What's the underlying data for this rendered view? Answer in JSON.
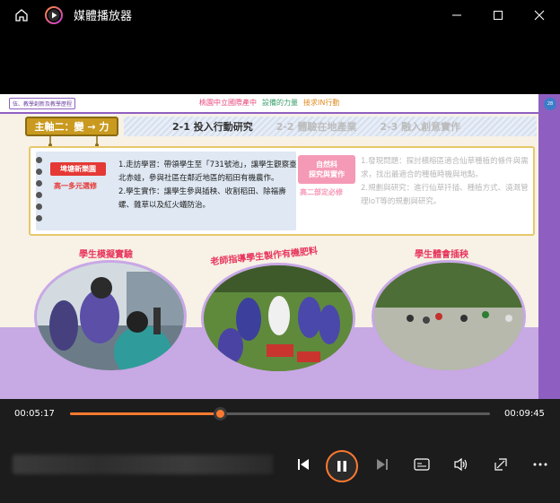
{
  "window": {
    "title": "媒體播放器",
    "home_icon": "home-icon",
    "app_icon": "media-player-logo-icon",
    "minimize_icon": "minimize-icon",
    "maximize_icon": "maximize-icon",
    "close_icon": "close-icon"
  },
  "slide": {
    "section_tag": "伍、教學創新及教學歷程",
    "banner": [
      "桃園中立國際產中",
      "設備的力量",
      "接求IN行動"
    ],
    "page_badge": "28",
    "axis_tab": "主軸二：變 → 力",
    "steps": [
      "2-1 投入行動研究",
      "2-2 體驗在地產業",
      "2-3 融入創意實作"
    ],
    "tag_left": "埤塘新樂園",
    "tag_left_sub": "高一多元選修",
    "text_left": [
      "1.走訪學習：帶領學生至「731號池」，讓學生觀察臺北赤蛙，參與社區在鄰近地區的稻田有機農作。",
      "2.學生實作：讓學生參與插秧、收割稻田、除福壽螺、雜草以及紅火蟻防治。"
    ],
    "tag_right_line1": "自然科",
    "tag_right_line2": "探究與實作",
    "tag_right_sub": "高二部定必修",
    "text_right": [
      "1.發現問題：探討橫榕區適合仙草種植的條件與需求，找出最適合的種植時機與地點。",
      "2.規劃與研究：進行仙草扦插、種植方式、澆溉管理IoT等的規劃與研究。"
    ],
    "photo_titles": [
      "學生模擬實驗",
      "老師指導學生製作有機肥料",
      "學生體會插秧"
    ]
  },
  "player": {
    "time_current": "00:05:17",
    "time_total": "00:09:45",
    "progress_fraction": 0.357,
    "accent_color": "#ff7a30",
    "icons": [
      "skip-previous-icon",
      "pause-icon",
      "skip-next-icon",
      "captions-icon",
      "volume-icon",
      "mini-player-icon",
      "more-icon"
    ]
  }
}
